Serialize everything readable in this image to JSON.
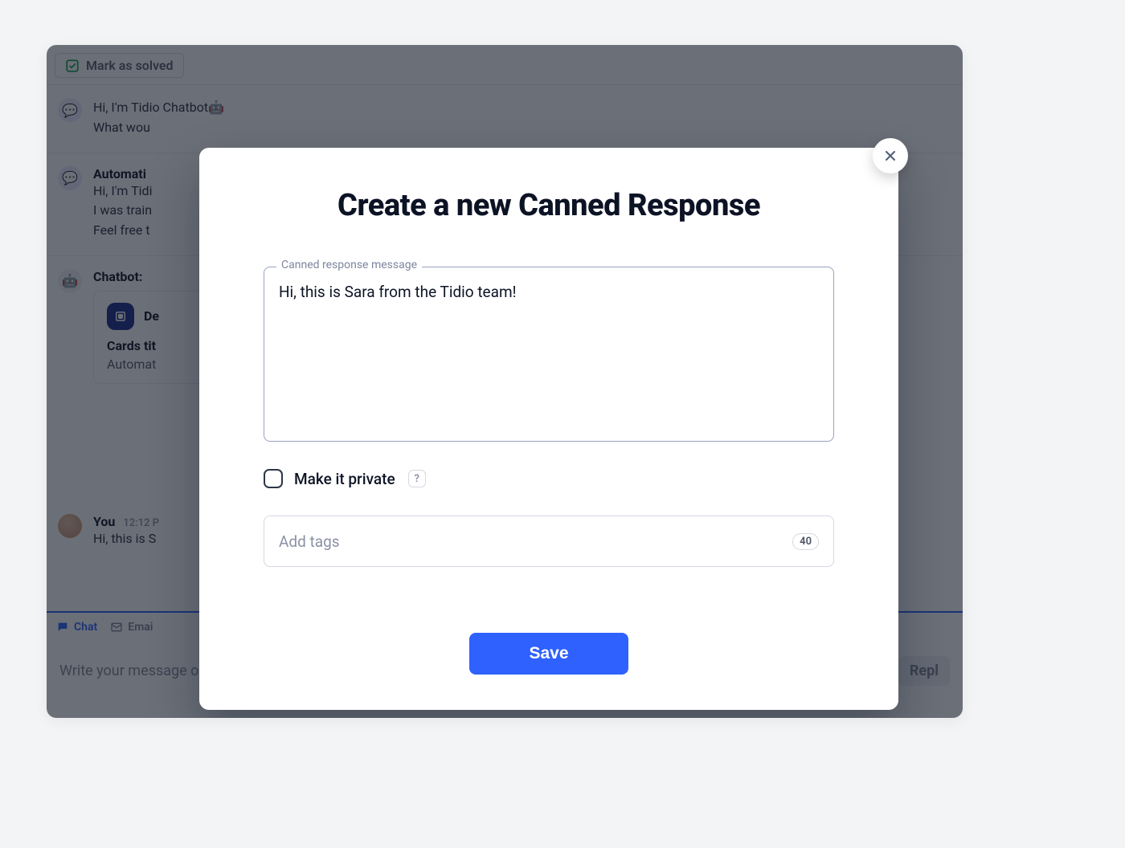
{
  "toolbar": {
    "mark_solved": "Mark as solved"
  },
  "messages": {
    "bot1_line1": "Hi, I'm Tidio Chatbot🤖",
    "bot1_line2": "What wou",
    "auto_name": "Automati",
    "auto_line1": "Hi, I'm Tidi",
    "auto_line2": "I was train",
    "auto_line3": "Feel free t",
    "chatbot_name": "Chatbot: ",
    "card_decision": "De",
    "card_title": "Cards tit",
    "card_sub": "Automat",
    "you_name": "You",
    "you_time": "12:12 P",
    "you_text": "Hi, this is S"
  },
  "composer": {
    "tab_chat": "Chat",
    "tab_email": "Emai",
    "placeholder": "Write your message or type / to pick a Canned Response",
    "reply": "Repl"
  },
  "modal": {
    "title": "Create a new Canned Response",
    "message_label": "Canned response message",
    "message_value": "Hi, this is Sara from the Tidio team!",
    "private_label": "Make it private",
    "help_glyph": "?",
    "tags_placeholder": "Add tags",
    "tags_count": "40",
    "save": "Save"
  }
}
